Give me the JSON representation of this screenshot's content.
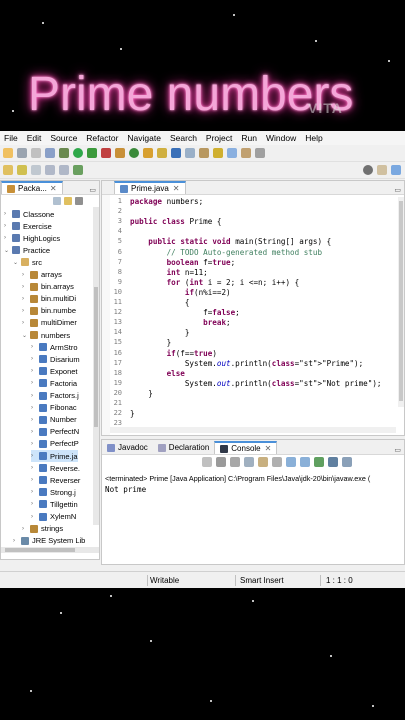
{
  "video_title": "Prime numbers",
  "watermark": "VITA",
  "menu": [
    "File",
    "Edit",
    "Source",
    "Refactor",
    "Navigate",
    "Search",
    "Project",
    "Run",
    "Window",
    "Help"
  ],
  "explorer": {
    "tab_label": "Packa...",
    "items": [
      {
        "label": "Classone",
        "depth": 0,
        "icon": "project"
      },
      {
        "label": "Exercise",
        "depth": 0,
        "icon": "project"
      },
      {
        "label": "HighLogics",
        "depth": 0,
        "icon": "project"
      },
      {
        "label": "Practice",
        "depth": 0,
        "icon": "project"
      },
      {
        "label": "src",
        "depth": 1,
        "icon": "folder"
      },
      {
        "label": "arrays",
        "depth": 2,
        "icon": "package"
      },
      {
        "label": "bin.arrays",
        "depth": 2,
        "icon": "package"
      },
      {
        "label": "bin.multiDi",
        "depth": 2,
        "icon": "package"
      },
      {
        "label": "bin.numbe",
        "depth": 2,
        "icon": "package"
      },
      {
        "label": "multiDimer",
        "depth": 2,
        "icon": "package"
      },
      {
        "label": "numbers",
        "depth": 2,
        "icon": "package"
      },
      {
        "label": "ArmStro",
        "depth": 3,
        "icon": "java"
      },
      {
        "label": "Disarium",
        "depth": 3,
        "icon": "java"
      },
      {
        "label": "Exponet",
        "depth": 3,
        "icon": "java"
      },
      {
        "label": "Factoria",
        "depth": 3,
        "icon": "java"
      },
      {
        "label": "Factors.j",
        "depth": 3,
        "icon": "java"
      },
      {
        "label": "Fibonac",
        "depth": 3,
        "icon": "java"
      },
      {
        "label": "Number",
        "depth": 3,
        "icon": "java"
      },
      {
        "label": "PerfectN",
        "depth": 3,
        "icon": "java"
      },
      {
        "label": "PerfectP",
        "depth": 3,
        "icon": "java"
      },
      {
        "label": "Prime.ja",
        "depth": 3,
        "icon": "java"
      },
      {
        "label": "Reverse.",
        "depth": 3,
        "icon": "java"
      },
      {
        "label": "Reverser",
        "depth": 3,
        "icon": "java"
      },
      {
        "label": "Strong.j",
        "depth": 3,
        "icon": "java"
      },
      {
        "label": "Tillgettin",
        "depth": 3,
        "icon": "java"
      },
      {
        "label": "XylemN",
        "depth": 3,
        "icon": "java"
      },
      {
        "label": "strings",
        "depth": 2,
        "icon": "package"
      },
      {
        "label": "JRE System Lib",
        "depth": 1,
        "icon": "library"
      }
    ]
  },
  "editor": {
    "tab_label": "Prime.java",
    "lines": [
      {
        "n": "1",
        "t": "package numbers;"
      },
      {
        "n": "2",
        "t": ""
      },
      {
        "n": "3",
        "t": "public class Prime {"
      },
      {
        "n": "4",
        "t": ""
      },
      {
        "n": "5",
        "t": "    public static void main(String[] args) {"
      },
      {
        "n": "6",
        "t": "        // TODO Auto-generated method stub"
      },
      {
        "n": "7",
        "t": "        boolean f=true;"
      },
      {
        "n": "8",
        "t": "        int n=11;"
      },
      {
        "n": "9",
        "t": "        for (int i = 2; i <=n; i++) {"
      },
      {
        "n": "10",
        "t": "            if(n%i==2)"
      },
      {
        "n": "11",
        "t": "            {"
      },
      {
        "n": "12",
        "t": "                f=false;"
      },
      {
        "n": "13",
        "t": "                break;"
      },
      {
        "n": "14",
        "t": "            }"
      },
      {
        "n": "15",
        "t": "        }"
      },
      {
        "n": "16",
        "t": "        if(f==true)"
      },
      {
        "n": "17",
        "t": "            System.out.println(\"Prime\");"
      },
      {
        "n": "18",
        "t": "        else"
      },
      {
        "n": "19",
        "t": "            System.out.println(\"Not prime\");"
      },
      {
        "n": "20",
        "t": "    }"
      },
      {
        "n": "21",
        "t": ""
      },
      {
        "n": "22",
        "t": "}"
      },
      {
        "n": "23",
        "t": ""
      }
    ]
  },
  "bottom_tabs": [
    "Javadoc",
    "Declaration",
    "Console"
  ],
  "console": {
    "header": "<terminated> Prime [Java Application] C:\\Program Files\\Java\\jdk-20\\bin\\javaw.exe (",
    "output": "Not prime"
  },
  "status": {
    "writable": "Writable",
    "insert": "Smart Insert",
    "position": "1 : 1 : 0"
  },
  "colors": {
    "title_glow": "#ff2fa6",
    "title_text": "#f4a6d8",
    "tab_accent": "#4a90d9"
  }
}
